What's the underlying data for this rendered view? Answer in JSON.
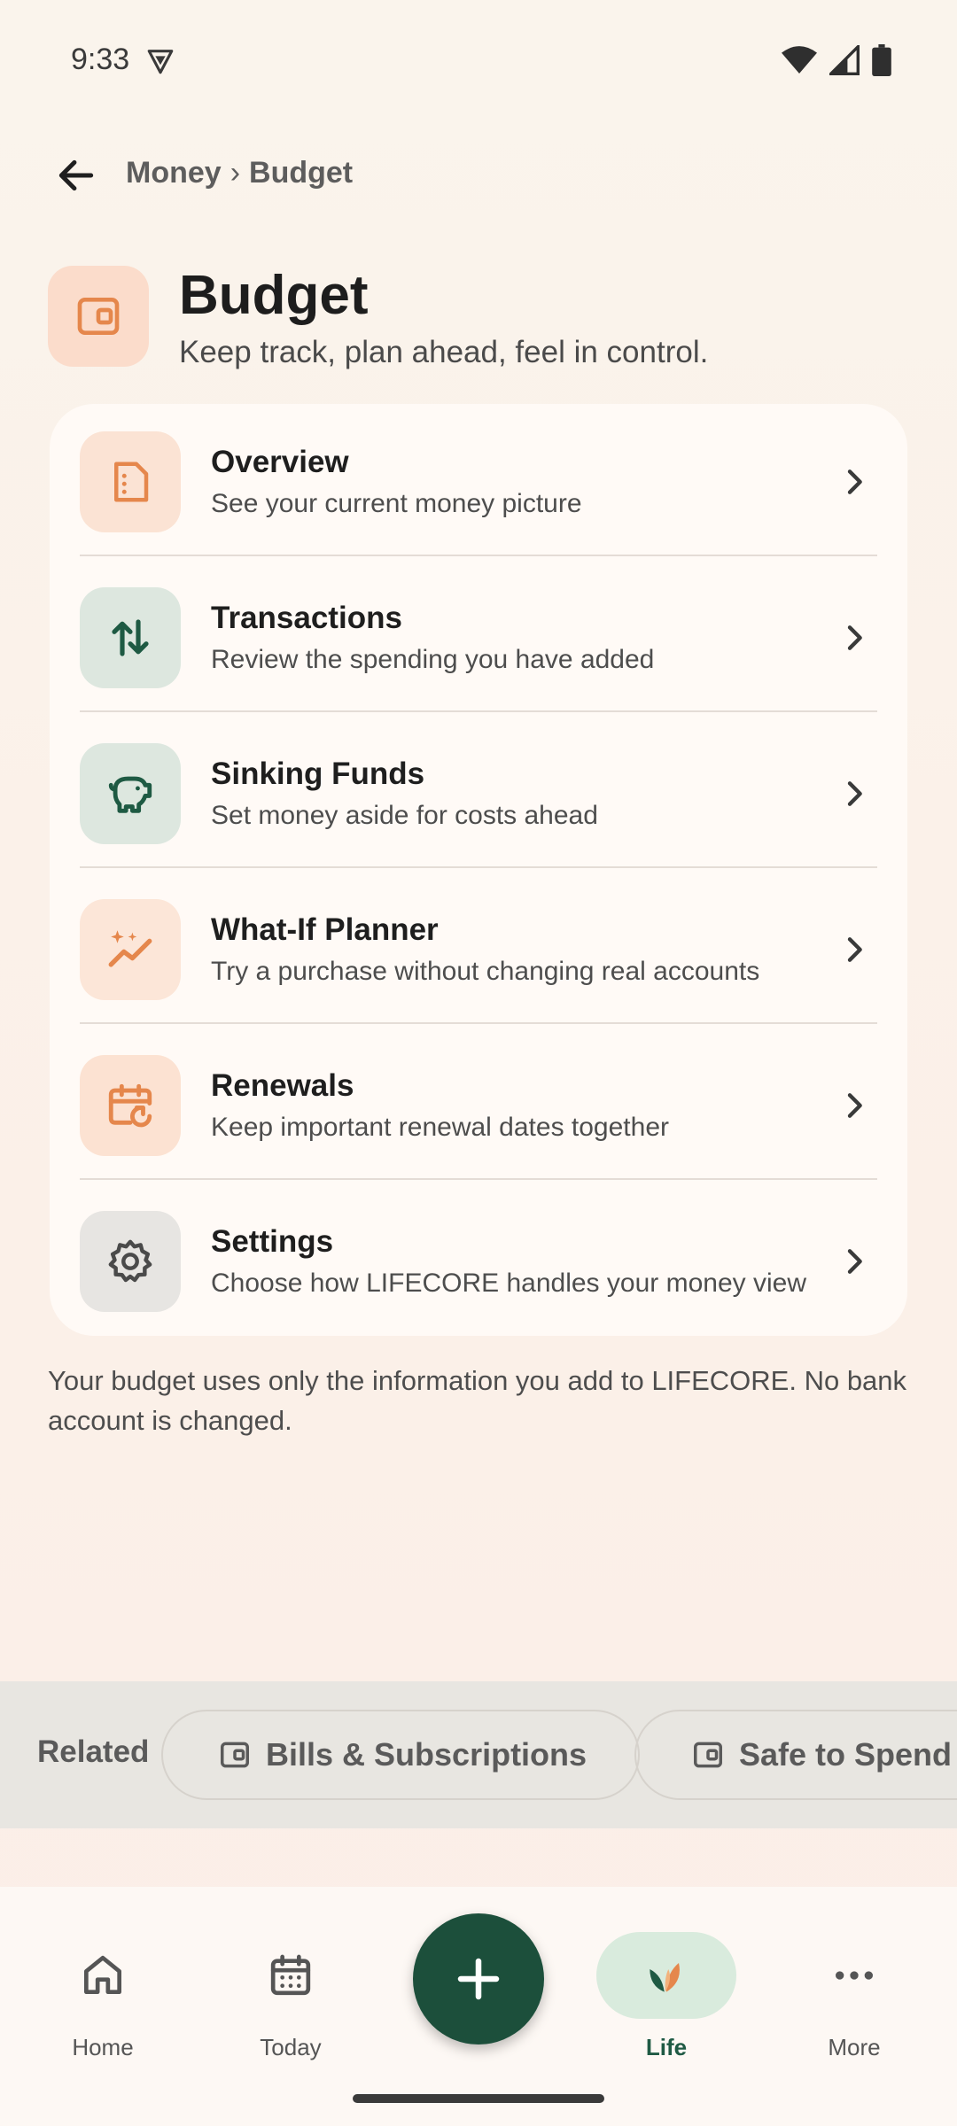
{
  "status_bar": {
    "time": "9:33"
  },
  "breadcrumb": {
    "parent": "Money",
    "separator": "›",
    "current": "Budget"
  },
  "hero": {
    "title": "Budget",
    "subtitle": "Keep track, plan ahead, feel in control."
  },
  "menu": {
    "items": [
      {
        "title": "Overview",
        "desc": "See your current money picture",
        "icon": "document-icon",
        "tint": "#fbe3d4",
        "icon_color": "#e5874c"
      },
      {
        "title": "Transactions",
        "desc": "Review the spending you have added",
        "icon": "swap-vertical-icon",
        "tint": "#dde7df",
        "icon_color": "#1e5a43"
      },
      {
        "title": "Sinking Funds",
        "desc": "Set money aside for costs ahead",
        "icon": "piggy-bank-icon",
        "tint": "#dde7df",
        "icon_color": "#1e5a43"
      },
      {
        "title": "What-If Planner",
        "desc": "Try a purchase without changing real accounts",
        "icon": "sparkle-trend-icon",
        "tint": "#fce6d8",
        "icon_color": "#e5874c"
      },
      {
        "title": "Renewals",
        "desc": "Keep important renewal dates together",
        "icon": "calendar-renew-icon",
        "tint": "#fce2d2",
        "icon_color": "#e5874c"
      },
      {
        "title": "Settings",
        "desc": "Choose how LIFECORE handles your money view",
        "icon": "gear-icon",
        "tint": "#e7e5e2",
        "icon_color": "#4a4a4a"
      }
    ]
  },
  "note": "Your budget uses only the information you add to LIFECORE. No bank account is changed.",
  "related": {
    "label": "Related",
    "chips": [
      {
        "label": "Bills & Subscriptions",
        "icon": "wallet-icon"
      },
      {
        "label": "Safe to Spend",
        "icon": "wallet-icon"
      }
    ]
  },
  "bottom_nav": {
    "items": [
      {
        "label": "Home",
        "icon": "home-icon"
      },
      {
        "label": "Today",
        "icon": "calendar-icon"
      },
      {
        "label": "Life",
        "icon": "leaf-icon",
        "active": true
      },
      {
        "label": "More",
        "icon": "more-icon"
      }
    ],
    "fab_icon": "plus-icon"
  },
  "colors": {
    "accent_green": "#1c4f3b",
    "accent_orange": "#e5874c",
    "background": "#faf4ec"
  }
}
